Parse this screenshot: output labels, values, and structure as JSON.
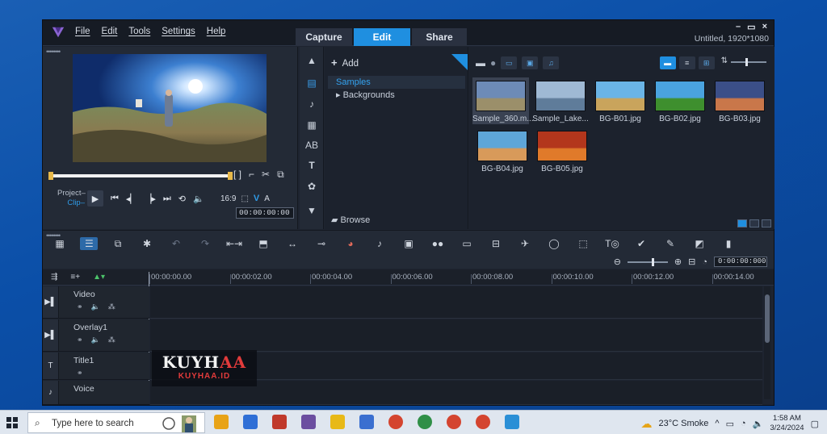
{
  "window": {
    "menu": [
      "File",
      "Edit",
      "Tools",
      "Settings",
      "Help"
    ],
    "modes": [
      "Capture",
      "Edit",
      "Share"
    ],
    "active_mode": "Edit",
    "project_info": "Untitled, 1920*1080",
    "controls": [
      "–",
      "▭",
      "×"
    ]
  },
  "player": {
    "project_label": "Project–",
    "clip_label": "Clip–",
    "timecode": "00:00:00:00",
    "aspect": "16:9",
    "v_label": "V",
    "a_label": "A"
  },
  "library": {
    "add_label": "Add",
    "tree": [
      {
        "label": "Samples",
        "selected": true
      },
      {
        "label": "Backgrounds",
        "selected": false
      }
    ],
    "browse_label": "Browse",
    "thumbnails": [
      {
        "name": "Sample_360.m...",
        "colors": [
          "#6d8bb7",
          "#9b8f6a"
        ],
        "selected": true
      },
      {
        "name": "Sample_Lake...",
        "colors": [
          "#9fb9d4",
          "#5f7c9a"
        ],
        "selected": false
      },
      {
        "name": "BG-B01.jpg",
        "colors": [
          "#6ab4e6",
          "#c9a45c"
        ],
        "selected": false
      },
      {
        "name": "BG-B02.jpg",
        "colors": [
          "#4aa3df",
          "#3e8f2e"
        ],
        "selected": false
      },
      {
        "name": "BG-B03.jpg",
        "colors": [
          "#3b4f88",
          "#c9774a"
        ],
        "selected": false
      },
      {
        "name": "BG-B04.jpg",
        "colors": [
          "#5ea6d8",
          "#d89a5a"
        ],
        "selected": false
      },
      {
        "name": "BG-B05.jpg",
        "colors": [
          "#b3361c",
          "#e07a2a"
        ],
        "selected": false
      }
    ]
  },
  "timeline": {
    "timecode": "0:00:00:000",
    "ruler_ticks": [
      "00:00:00.00",
      "00:00:02.00",
      "00:00:04.00",
      "00:00:06.00",
      "00:00:08.00",
      "00:00:10.00",
      "00:00:12.00",
      "00:00:14.00"
    ],
    "tracks": [
      {
        "name": "Video",
        "icon": "video-icon"
      },
      {
        "name": "Overlay1",
        "icon": "overlay-icon"
      },
      {
        "name": "Title1",
        "icon": "title-icon"
      },
      {
        "name": "Voice",
        "icon": "voice-icon"
      }
    ]
  },
  "watermark": {
    "main_white": "KUYH",
    "main_red": "AA",
    "sub": "KUYHAA.ID"
  },
  "taskbar": {
    "search_placeholder": "Type here to search",
    "weather": "23°C  Smoke",
    "time": "1:58 AM",
    "date": "3/24/2024",
    "app_colors": [
      "#e8a317",
      "#2f6fd6",
      "#c0392b",
      "#6b4ea0",
      "#e8b917",
      "#3a6fd0",
      "#d4442f",
      "#2f8f47",
      "#d4442f",
      "#d4442f",
      "#2a8fd6"
    ]
  },
  "colors": {
    "accent": "#1f8fe0",
    "panel": "#232a36",
    "tree_selected_text": "#34a3f0"
  }
}
